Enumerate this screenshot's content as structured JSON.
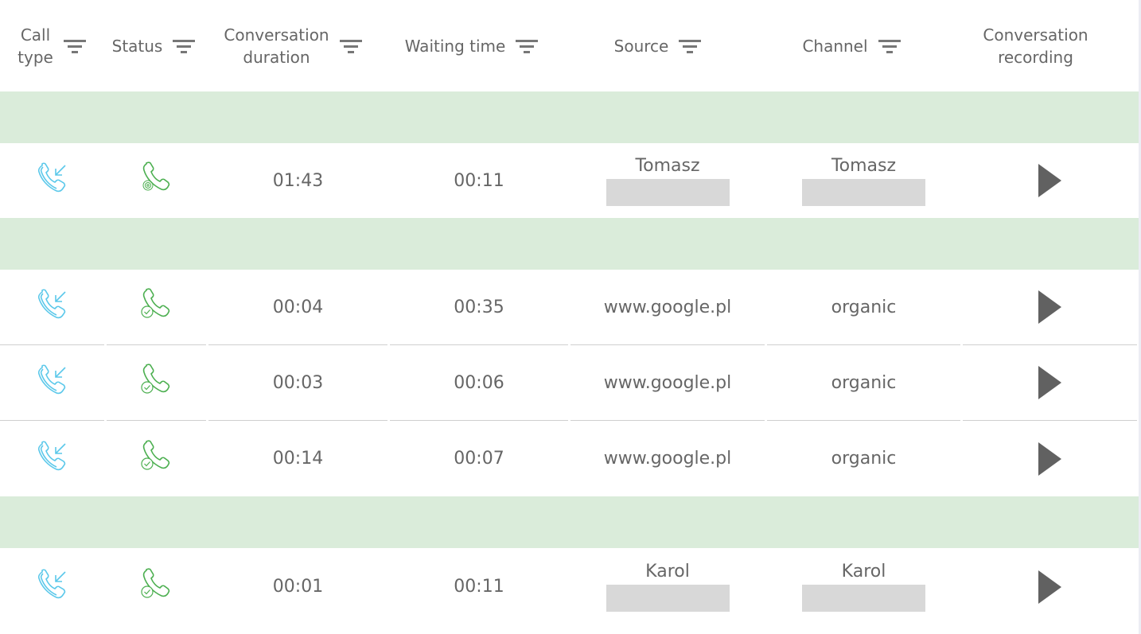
{
  "columns": [
    {
      "label": "Call type",
      "filter": true
    },
    {
      "label": "Status",
      "filter": true
    },
    {
      "label": "Conversation duration",
      "filter": true
    },
    {
      "label": "Waiting time",
      "filter": true
    },
    {
      "label": "Source",
      "filter": true
    },
    {
      "label": "Channel",
      "filter": true
    },
    {
      "label": "Conversation recording",
      "filter": false
    }
  ],
  "header_lines": {
    "call_type": [
      "Call",
      "type"
    ],
    "conv_duration": [
      "Conversation",
      "duration"
    ],
    "conv_recording": [
      "Conversation",
      "recording"
    ]
  },
  "colors": {
    "incoming_icon": "#5bc8ea",
    "status_icon": "#4caf50",
    "group_row_bg": "#daecda",
    "play_button": "#616161"
  },
  "rows": [
    {
      "call_type_icon": "incoming-call-icon",
      "status_icon": "call-target-icon",
      "duration": "01:43",
      "waiting": "00:11",
      "source": "Tomasz",
      "source_redacted": true,
      "channel": "Tomasz",
      "channel_redacted": true
    },
    {
      "call_type_icon": "incoming-call-icon",
      "status_icon": "call-answered-icon",
      "duration": "00:04",
      "waiting": "00:35",
      "source": "www.google.pl",
      "channel": "organic"
    },
    {
      "call_type_icon": "incoming-call-icon",
      "status_icon": "call-answered-icon",
      "duration": "00:03",
      "waiting": "00:06",
      "source": "www.google.pl",
      "channel": "organic"
    },
    {
      "call_type_icon": "incoming-call-icon",
      "status_icon": "call-answered-icon",
      "duration": "00:14",
      "waiting": "00:07",
      "source": "www.google.pl",
      "channel": "organic"
    },
    {
      "call_type_icon": "incoming-call-icon",
      "status_icon": "call-answered-icon",
      "duration": "00:01",
      "waiting": "00:11",
      "source": "Karol",
      "source_redacted": true,
      "channel": "Karol",
      "channel_redacted": true
    }
  ]
}
